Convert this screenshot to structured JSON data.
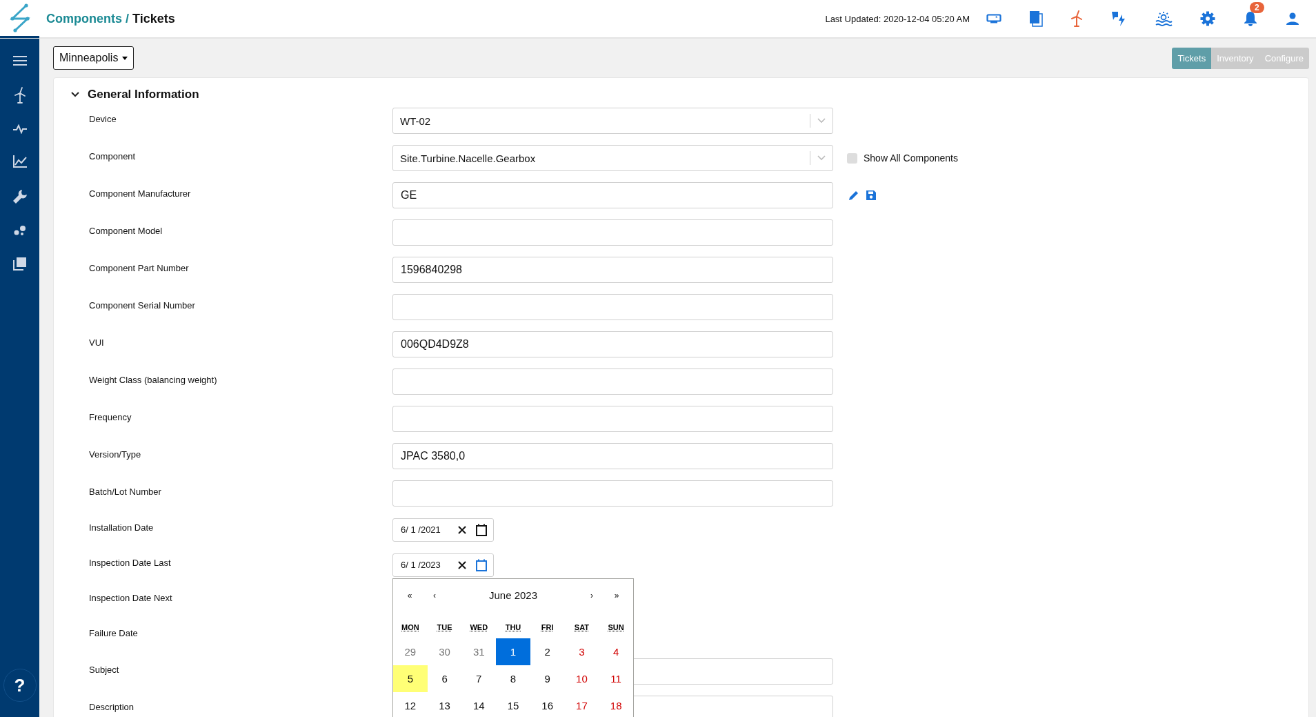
{
  "header": {
    "breadcrumb": [
      {
        "label": "Components",
        "kind": "link"
      },
      {
        "label": "/",
        "kind": "separator"
      },
      {
        "label": "Tickets",
        "kind": "current"
      }
    ],
    "last_updated": "Last Updated: 2020-12-04 05:20 AM",
    "notification_count": "2"
  },
  "sidebar": {
    "help": "?"
  },
  "site_selector": {
    "value": "Minneapolis"
  },
  "tabs": [
    {
      "label": "Tickets",
      "selected": true
    },
    {
      "label": "Inventory",
      "selected": false
    },
    {
      "label": "Configure",
      "selected": false
    }
  ],
  "section": {
    "title": "General Information",
    "expanded": true,
    "fields": [
      {
        "label": "Device",
        "kind": "select",
        "value": "WT-02"
      },
      {
        "label": "Component",
        "kind": "select",
        "value": "Site.Turbine.Nacelle.Gearbox",
        "option": {
          "label": "Show All Components",
          "checked": false
        }
      },
      {
        "label": "Component Manufacturer",
        "kind": "text",
        "value": "GE",
        "editable": true
      },
      {
        "label": "Component Model",
        "kind": "text"
      },
      {
        "label": "Component Part Number",
        "kind": "text",
        "value": "1596840298"
      },
      {
        "label": "Component Serial Number",
        "kind": "text"
      },
      {
        "label": "VUI",
        "kind": "text",
        "value": "006QD4D9Z8"
      },
      {
        "label": "Weight Class (balancing weight)",
        "kind": "text"
      },
      {
        "label": "Frequency",
        "kind": "text"
      },
      {
        "label": "Version/Type",
        "kind": "text",
        "value": "JPAC 3580,0"
      },
      {
        "label": "Batch/Lot Number",
        "kind": "text"
      },
      {
        "label": "Installation Date",
        "kind": "date",
        "value": "6/ 1 /2021"
      },
      {
        "label": "Inspection Date Last",
        "kind": "date",
        "value": "6/ 1 /2023",
        "open": true
      },
      {
        "label": "Inspection Date Next",
        "kind": "date"
      },
      {
        "label": "Failure Date",
        "kind": "date"
      },
      {
        "label": "Subject",
        "kind": "text"
      },
      {
        "label": "Description",
        "kind": "text"
      }
    ]
  },
  "calendar": {
    "month": "June 2023",
    "nav": [
      "«",
      "‹",
      "›",
      "»"
    ],
    "weekdays": [
      "MON",
      "TUE",
      "WED",
      "THU",
      "FRI",
      "SAT",
      "SUN"
    ],
    "days": [
      {
        "label": "29",
        "muted": true,
        "weekend": false,
        "selected": false,
        "today": false
      },
      {
        "label": "30",
        "muted": true,
        "weekend": false,
        "selected": false,
        "today": false
      },
      {
        "label": "31",
        "muted": true,
        "weekend": false,
        "selected": false,
        "today": false
      },
      {
        "label": "1",
        "muted": false,
        "weekend": false,
        "selected": true,
        "today": false
      },
      {
        "label": "2",
        "muted": false,
        "weekend": false,
        "selected": false,
        "today": false
      },
      {
        "label": "3",
        "muted": false,
        "weekend": true,
        "selected": false,
        "today": false
      },
      {
        "label": "4",
        "muted": false,
        "weekend": true,
        "selected": false,
        "today": false
      },
      {
        "label": "5",
        "muted": false,
        "weekend": false,
        "selected": false,
        "today": true
      },
      {
        "label": "6",
        "muted": false,
        "weekend": false,
        "selected": false,
        "today": false
      },
      {
        "label": "7",
        "muted": false,
        "weekend": false,
        "selected": false,
        "today": false
      },
      {
        "label": "8",
        "muted": false,
        "weekend": false,
        "selected": false,
        "today": false
      },
      {
        "label": "9",
        "muted": false,
        "weekend": false,
        "selected": false,
        "today": false
      },
      {
        "label": "10",
        "muted": false,
        "weekend": true,
        "selected": false,
        "today": false
      },
      {
        "label": "11",
        "muted": false,
        "weekend": true,
        "selected": false,
        "today": false
      },
      {
        "label": "12",
        "muted": false,
        "weekend": false,
        "selected": false,
        "today": false
      },
      {
        "label": "13",
        "muted": false,
        "weekend": false,
        "selected": false,
        "today": false
      },
      {
        "label": "14",
        "muted": false,
        "weekend": false,
        "selected": false,
        "today": false
      },
      {
        "label": "15",
        "muted": false,
        "weekend": false,
        "selected": false,
        "today": false
      },
      {
        "label": "16",
        "muted": false,
        "weekend": false,
        "selected": false,
        "today": false
      },
      {
        "label": "17",
        "muted": false,
        "weekend": true,
        "selected": false,
        "today": false
      },
      {
        "label": "18",
        "muted": false,
        "weekend": true,
        "selected": false,
        "today": false
      }
    ]
  }
}
